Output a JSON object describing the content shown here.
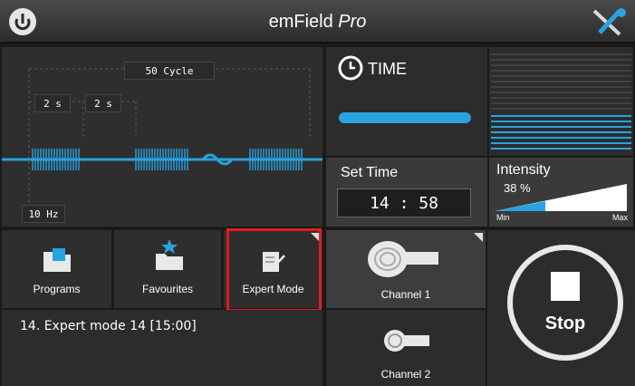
{
  "header": {
    "app_name": "emField",
    "app_variant": "Pro"
  },
  "icons": {
    "logo": "power-logo-icon",
    "settings": "tools-icon"
  },
  "colors": {
    "accent": "#27a3e0",
    "highlight": "#e21b1b"
  },
  "waveform": {
    "cycle_label": "50 Cycle",
    "on_time": "2 s",
    "off_time": "2 s",
    "frequency": "10 Hz"
  },
  "time_panel": {
    "label": "TIME",
    "progress": 1.0
  },
  "set_time": {
    "label": "Set Time",
    "value": "14 : 58"
  },
  "intensity": {
    "label": "Intensity",
    "value": "38 %",
    "level": 0.38,
    "min_label": "Min",
    "max_label": "Max"
  },
  "tiles": {
    "programs": "Programs",
    "favourites": "Favourites",
    "expert": "Expert Mode"
  },
  "program_text": "14.  Expert mode 14 [15:00]",
  "channels": {
    "ch1": "Channel 1",
    "ch2": "Channel 2"
  },
  "stop": {
    "label": "Stop"
  }
}
